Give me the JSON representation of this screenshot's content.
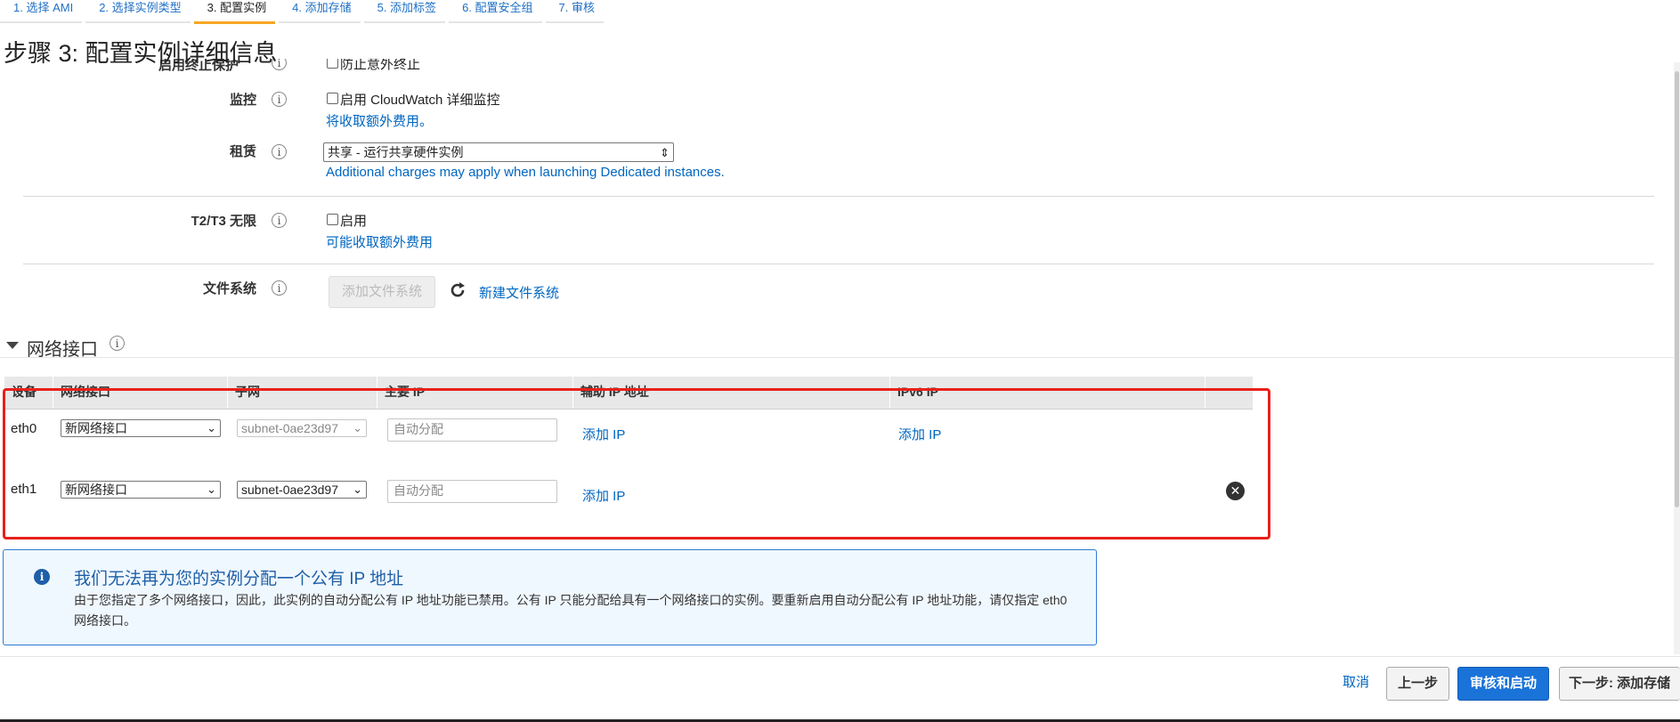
{
  "steps": [
    {
      "label": "1. 选择 AMI"
    },
    {
      "label": "2. 选择实例类型"
    },
    {
      "label": "3. 配置实例"
    },
    {
      "label": "4. 添加存储"
    },
    {
      "label": "5. 添加标签"
    },
    {
      "label": "6. 配置安全组"
    },
    {
      "label": "7. 审核"
    }
  ],
  "page_title": "步骤 3: 配置实例详细信息",
  "form": {
    "termination": {
      "label": "启用终止保护",
      "checkbox_label": "防止意外终止"
    },
    "monitoring": {
      "label": "监控",
      "checkbox_label": "启用 CloudWatch 详细监控",
      "link": "将收取额外费用。"
    },
    "tenancy": {
      "label": "租赁",
      "value": "共享 - 运行共享硬件实例",
      "note": "Additional charges may apply when launching Dedicated instances."
    },
    "t2t3": {
      "label": "T2/T3 无限",
      "checkbox_label": "启用",
      "link": "可能收取额外费用"
    },
    "filesystem": {
      "label": "文件系统",
      "add_button": "添加文件系统",
      "create_link": "新建文件系统"
    }
  },
  "network": {
    "title": "网络接口",
    "columns": [
      "设备",
      "网络接口",
      "子网",
      "主要 IP",
      "辅助 IP 地址",
      "IPv6 IP"
    ],
    "rows": [
      {
        "device": "eth0",
        "interface": "新网络接口",
        "subnet": "subnet-0ae23d97",
        "primary_ip_placeholder": "自动分配",
        "secondary_ip": "添加 IP",
        "ipv6": "添加 IP"
      },
      {
        "device": "eth1",
        "interface": "新网络接口",
        "subnet": "subnet-0ae23d97",
        "primary_ip_placeholder": "自动分配",
        "secondary_ip": "添加 IP",
        "ipv6": ""
      }
    ]
  },
  "alert": {
    "title": "我们无法再为您的实例分配一个公有 IP 地址",
    "body": "由于您指定了多个网络接口，因此，此实例的自动分配公有 IP 地址功能已禁用。公有 IP 只能分配给具有一个网络接口的实例。要重新启用自动分配公有 IP 地址功能，请仅指定 eth0 网络接口。"
  },
  "footer": {
    "cancel": "取消",
    "previous": "上一步",
    "review_launch": "审核和启动",
    "next": "下一步: 添加存储"
  },
  "colors": {
    "link": "#0066c0",
    "primary": "#1a73d9",
    "highlight_box": "#e8201a",
    "active_tab": "#f5a623"
  }
}
